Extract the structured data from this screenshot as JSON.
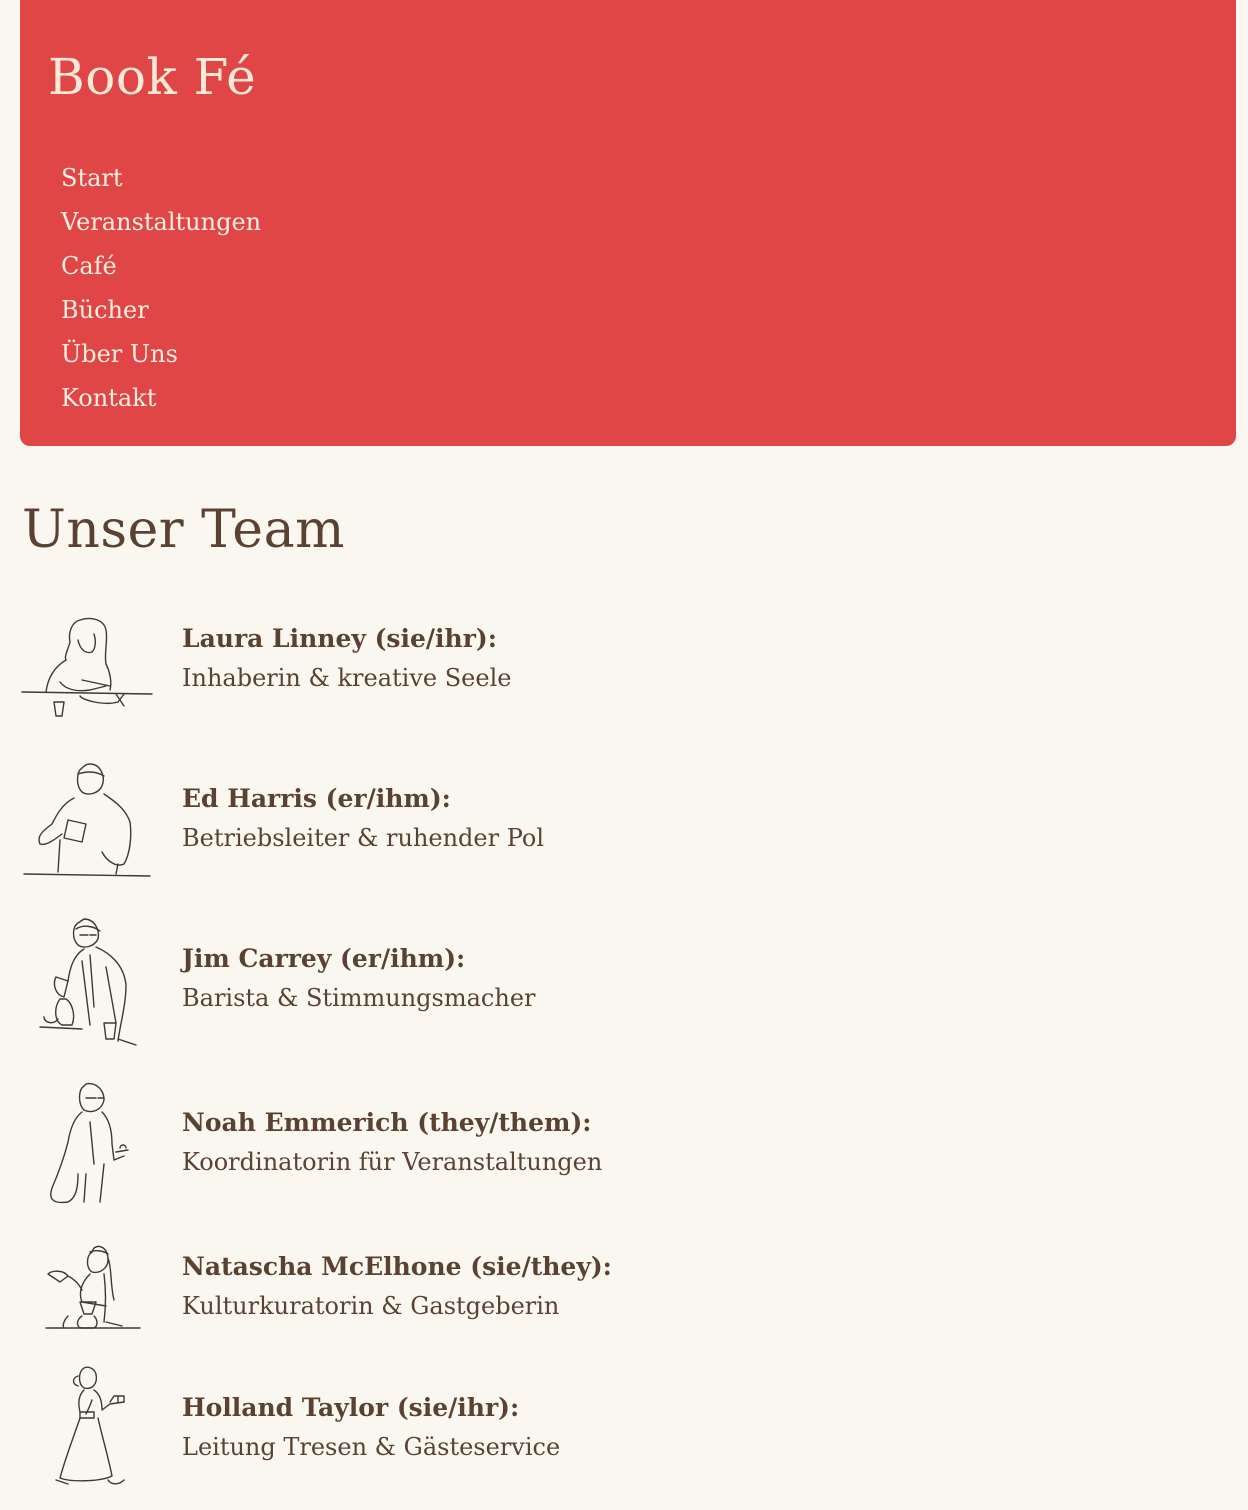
{
  "brand": "Book Fé",
  "nav": {
    "items": [
      "Start",
      "Veranstaltungen",
      "Café",
      "Bücher",
      "Über Uns",
      "Kontakt"
    ]
  },
  "team": {
    "title": "Unser Team",
    "members": [
      {
        "name": "Laura Linney (sie/ihr):",
        "role": "Inhaberin & kreative Seele",
        "icon": "person-writing-at-table-icon"
      },
      {
        "name": "Ed Harris (er/ihm):",
        "role": "Betriebsleiter & ruhender Pol",
        "icon": "person-pouring-milk-icon"
      },
      {
        "name": "Jim Carrey (er/ihm):",
        "role": "Barista & Stimmungsmacher",
        "icon": "barista-with-coffee-pots-icon"
      },
      {
        "name": "Noah Emmerich (they/them):",
        "role": "Koordinatorin für Veranstaltungen",
        "icon": "person-with-bag-and-tray-icon"
      },
      {
        "name": "Natascha McElhone (sie/they):",
        "role": "Kulturkuratorin & Gastgeberin",
        "icon": "person-brewing-pour-over-icon"
      },
      {
        "name": "Holland Taylor (sie/ihr):",
        "role": "Leitung Tresen & Gästeservice",
        "icon": "person-in-dress-serving-icon"
      }
    ]
  },
  "colors": {
    "header": "#e04646",
    "background": "#faf7f0",
    "text": "#5a4232"
  }
}
